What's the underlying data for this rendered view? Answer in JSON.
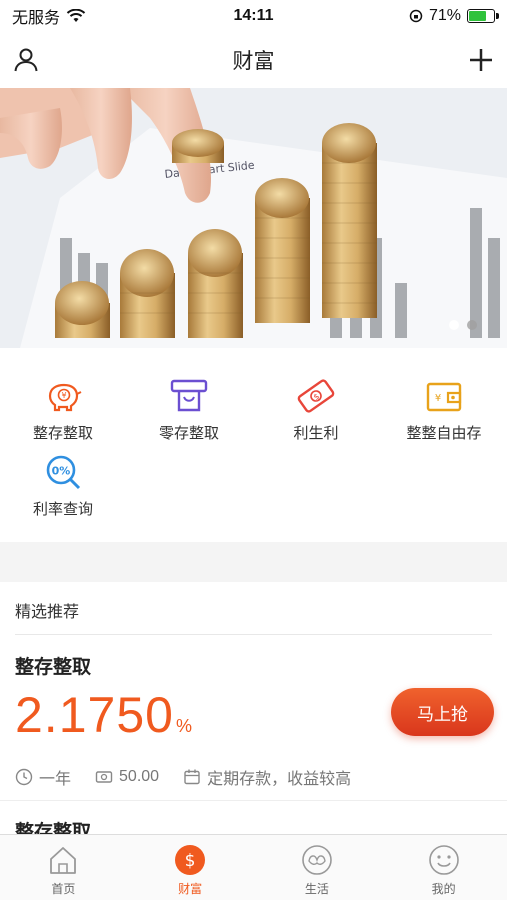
{
  "status_bar": {
    "carrier": "无服务",
    "time": "14:11",
    "battery_percent": "71%",
    "battery_level": 0.71
  },
  "nav": {
    "title": "财富"
  },
  "banner": {
    "slide_count": 2,
    "active_index": 0,
    "chart_caption": "Data Chart Slide"
  },
  "menu": {
    "items": [
      {
        "label": "整存整取",
        "icon": "piggy-bank-icon"
      },
      {
        "label": "零存整取",
        "icon": "atm-icon"
      },
      {
        "label": "利生利",
        "icon": "money-bill-icon"
      },
      {
        "label": "整整自由存",
        "icon": "wallet-icon"
      },
      {
        "label": "利率查询",
        "icon": "rate-search-icon"
      }
    ]
  },
  "recommend": {
    "header": "精选推荐",
    "product": {
      "name": "整存整取",
      "rate": "2.1750",
      "rate_unit": "%",
      "buy_label": "马上抢",
      "term": "一年",
      "min_amount": "50.00",
      "description": "定期存款，收益较高"
    },
    "next_product_name": "整存整取"
  },
  "tabs": [
    {
      "label": "首页",
      "icon": "home-icon",
      "active": false
    },
    {
      "label": "财富",
      "icon": "dollar-icon",
      "active": true
    },
    {
      "label": "生活",
      "icon": "leaf-icon",
      "active": false
    },
    {
      "label": "我的",
      "icon": "smiley-icon",
      "active": false
    }
  ],
  "colors": {
    "accent": "#f05a1f",
    "icon_orange": "#f05a1f",
    "icon_purple": "#6b4fd1",
    "icon_red": "#e8463a",
    "icon_yellow": "#e8a21a",
    "icon_blue": "#2f8fe0"
  }
}
